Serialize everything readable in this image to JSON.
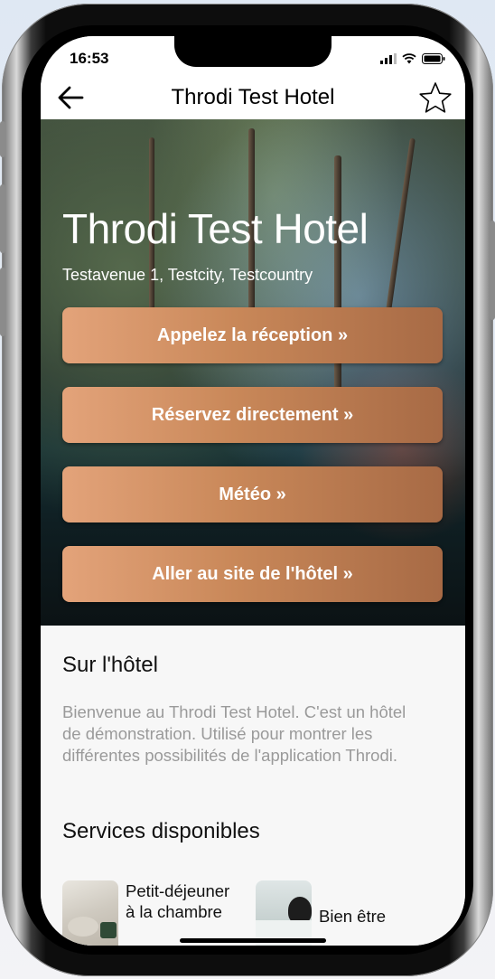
{
  "status_bar": {
    "time": "16:53"
  },
  "nav": {
    "title": "Throdi Test Hotel"
  },
  "hero": {
    "title": "Throdi Test Hotel",
    "address": "Testavenue 1, Testcity, Testcountry"
  },
  "actions": [
    {
      "label": "Appelez la réception »"
    },
    {
      "label": "Réservez directement »"
    },
    {
      "label": "Météo »"
    },
    {
      "label": "Aller au site de l'hôtel »"
    }
  ],
  "about": {
    "title": "Sur l'hôtel",
    "text": "Bienvenue au Throdi Test Hotel. C'est un hôtel de démonstration. Utilisé pour montrer les différentes possibilités de l'application Throdi."
  },
  "services": {
    "title": "Services disponibles",
    "items": [
      {
        "label": "Petit-déjeuner à la chambre"
      },
      {
        "label": "Bien être"
      }
    ]
  },
  "colors": {
    "button_gradient_start": "#e3a37a",
    "button_gradient_end": "#a76a45",
    "body_text_muted": "#9a9a9a"
  },
  "icons": [
    "back-arrow-icon",
    "favorite-star-icon",
    "signal-icon",
    "wifi-icon",
    "battery-icon"
  ]
}
